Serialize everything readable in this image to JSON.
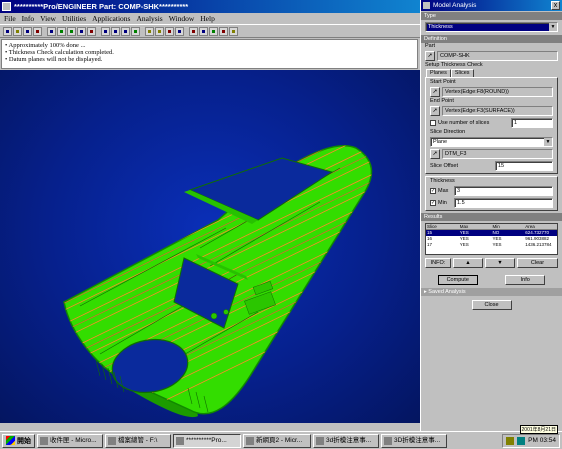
{
  "main_window": {
    "title": "**********Pro/ENGINEER Part: COMP-SHK**********",
    "menu": [
      "File",
      "Info",
      "View",
      "Utilities",
      "Applications",
      "Analysis",
      "Window",
      "Help"
    ],
    "messages": [
      "• Approximately 100% done ...",
      "• Thickness Check calculation completed.",
      "• Datum planes will not be displayed."
    ]
  },
  "dialog": {
    "title": "Model Analysis",
    "close_glyph": "x",
    "type_label": "Type",
    "type_value": "Thickness",
    "definition_label": "Definition",
    "part_label": "Part",
    "part_value": "COMP-SHK",
    "setup_label": "Setup Thickness Check",
    "tabs": [
      "Planes",
      "Slices"
    ],
    "start_point_label": "Start Point",
    "start_point_value": "Vertex(Edge:F8(ROUND))",
    "end_point_label": "End Point",
    "end_point_value": "Vertex(Edge:F3(SURFACE))",
    "use_number_label": "Use number of slices",
    "use_number_value": "1",
    "slice_direction_label": "Slice Direction",
    "slice_direction_value": "Plane",
    "direction_ref_value": "DTM_F3",
    "slice_offset_label": "Slice Offset",
    "slice_offset_value": "15",
    "thickness_label": "Thickness",
    "max_label": "Max",
    "max_value": "3",
    "min_label": "Min",
    "min_value": "1.5",
    "results_label": "Results",
    "results_headers": [
      "Slice",
      "Max",
      "Min",
      "Area"
    ],
    "results_rows": [
      [
        "15",
        "YES",
        "NO",
        "624.732770"
      ],
      [
        "16",
        "YES",
        "YES",
        "961.903882"
      ],
      [
        "17",
        "YES",
        "YES",
        "1436.213784"
      ]
    ],
    "info_label": "INFO:",
    "clear_label": "Clear",
    "compute_label": "Compute",
    "info_button_label": "Info",
    "saved_analysis_label": "Saved Analysis",
    "close_label": "Close"
  },
  "taskbar": {
    "start_label": "開始",
    "tasks": [
      "收件匣 - Micro...",
      "檔案總管 - F:\\",
      "**********Pro...",
      "新網頁2 - Micr...",
      "3d折模注意事...",
      "3D折模注意事..."
    ],
    "clock": "PM 03:54",
    "date_tooltip": "2001年8月21日"
  },
  "colors": {
    "titlebar": "#000080",
    "viewport_bg": "#06208c",
    "model_green": "#33dd00",
    "slice_orange": "#ff8a2a"
  }
}
